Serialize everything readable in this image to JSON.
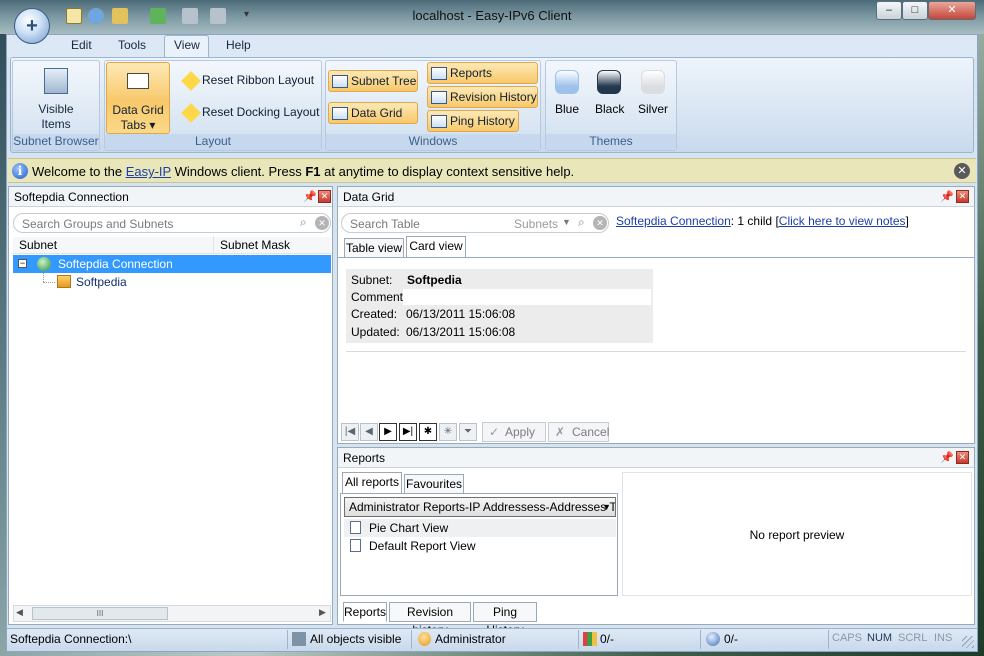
{
  "window": {
    "title": "localhost - Easy-IPv6 Client",
    "controls": {
      "minimize": "–",
      "maximize": "□",
      "close": "✕"
    }
  },
  "menu": {
    "items": [
      "Edit",
      "Tools",
      "View",
      "Help"
    ],
    "active": "View"
  },
  "ribbon": {
    "subnet_browser": {
      "button": [
        "Visible",
        "Items"
      ],
      "group_label": "Subnet Browser"
    },
    "layout": {
      "data_grid_tabs": [
        "Data Grid",
        "Tabs ▾"
      ],
      "reset_ribbon": "Reset Ribbon Layout",
      "reset_docking": "Reset Docking Layout",
      "group_label": "Layout"
    },
    "windows": {
      "subnet_tree": "Subnet Tree",
      "data_grid": "Data Grid",
      "reports": "Reports",
      "revision_history": "Revision History",
      "ping_history": "Ping History",
      "group_label": "Windows"
    },
    "themes": {
      "items": [
        {
          "label": "Blue",
          "color": "#9ec2ec"
        },
        {
          "label": "Black",
          "color": "#23374f"
        },
        {
          "label": "Silver",
          "color": "#dadde2"
        }
      ],
      "group_label": "Themes"
    }
  },
  "infobar": {
    "prefix": "Welcome to the ",
    "link": "Easy-IP",
    "middle": " Windows client. Press ",
    "key": "F1",
    "suffix": " at anytime to display context sensitive help."
  },
  "left_panel": {
    "title": "Softepdia Connection",
    "search_placeholder": "Search Groups and Subnets",
    "columns": [
      "Subnet",
      "Subnet Mask"
    ],
    "tree": {
      "root": "Softepdia Connection",
      "child": "Softpedia"
    },
    "scroll_mark": "III"
  },
  "data_grid": {
    "title": "Data Grid",
    "search_placeholder": "Search Table",
    "search_scope": "Subnets",
    "connection_link": "Softepdia Connection",
    "child_count": ":  1 child [",
    "notes_link": "Click here to view notes",
    "notes_close": "]",
    "tabs": [
      "Table view",
      "Card view"
    ],
    "active_tab": "Card view",
    "card": {
      "subnet_label": "Subnet:",
      "subnet_value": "Softpedia",
      "comment_label": "Comment:",
      "comment_value": "",
      "created_label": "Created:",
      "created_value": "06/13/2011 15:06:08",
      "updated_label": "Updated:",
      "updated_value": "06/13/2011 15:06:08"
    },
    "apply": "Apply",
    "cancel": "Cancel"
  },
  "reports": {
    "title": "Reports",
    "tabs": [
      "All reports",
      "Favourites"
    ],
    "dropdown": "Administrator Reports-IP Addressess-Addresses Typ",
    "items": [
      "Pie Chart View",
      "Default Report View"
    ],
    "preview": "No report preview",
    "bottom_tabs": [
      "Reports",
      "Revision history",
      "Ping History"
    ]
  },
  "status": {
    "path": "Softepdia Connection:\\",
    "visibility": "All objects visible",
    "user": "Administrator",
    "counter1": "0/-",
    "counter2": "0/-",
    "keys": [
      "CAPS",
      "NUM",
      "SCRL",
      "INS"
    ]
  }
}
